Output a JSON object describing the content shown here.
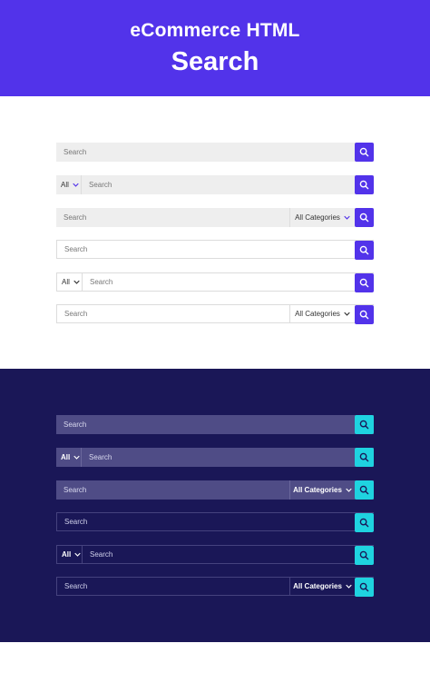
{
  "header": {
    "line1": "eCommerce HTML",
    "line2": "Search"
  },
  "search": {
    "placeholder": "Search",
    "all_label": "All",
    "categories_label": "All Categories",
    "search_icon": "search-icon",
    "chevron_icon": "chevron-down-icon"
  },
  "colors": {
    "brand_purple": "#5233ea",
    "dark_navy": "#1a1757",
    "accent_cyan": "#1fd3e0"
  }
}
